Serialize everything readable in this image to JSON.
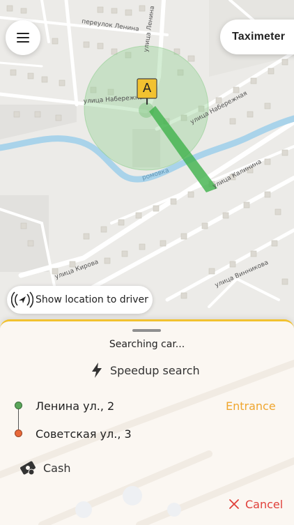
{
  "map": {
    "streets": [
      "переулок Ленина",
      "улица Ленина",
      "улица Набережная",
      "улица Набережная",
      "улица Калинина",
      "улица Кирова",
      "улица Винникова"
    ],
    "river_label": "ромовка",
    "pin_label": "A"
  },
  "top_bar": {
    "menu_icon": "hamburger-menu-icon",
    "taximeter_label": "Taximeter"
  },
  "show_location": {
    "icon": "location-broadcast-icon",
    "label": "Show location to driver"
  },
  "sheet": {
    "status": "Searching car...",
    "speedup_label": "Speedup search",
    "speedup_icon": "lightning-icon",
    "route": {
      "from": "Ленина ул., 2",
      "to": "Советская ул., 3",
      "entrance_label": "Entrance"
    },
    "payment_label": "Cash",
    "payment_icon": "cash-icon",
    "cancel_label": "Cancel",
    "cancel_icon": "close-icon"
  },
  "colors": {
    "accent_yellow": "#f2c230",
    "entrance": "#efa62f",
    "cancel": "#e0403a",
    "origin_dot": "#5aa65a",
    "destination_dot": "#e8693a",
    "search_radius": "#8fcf8f",
    "river": "#a9d3ea"
  }
}
